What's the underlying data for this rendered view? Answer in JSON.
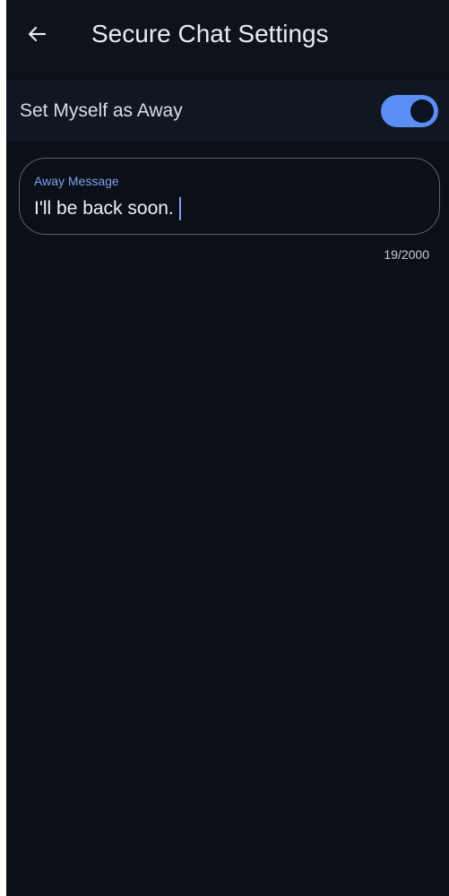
{
  "header": {
    "title": "Secure Chat Settings",
    "back_icon": "arrow-left-icon"
  },
  "away_setting": {
    "label": "Set Myself as Away",
    "enabled": true,
    "accent_color": "#5b8ef5"
  },
  "away_message": {
    "label": "Away Message",
    "value": "I'll be back soon.",
    "counter": "19/2000"
  },
  "colors": {
    "background": "#0b0f17",
    "header_bg": "#0d121b",
    "row_bg": "#111722",
    "label_accent": "#7da2ec"
  }
}
